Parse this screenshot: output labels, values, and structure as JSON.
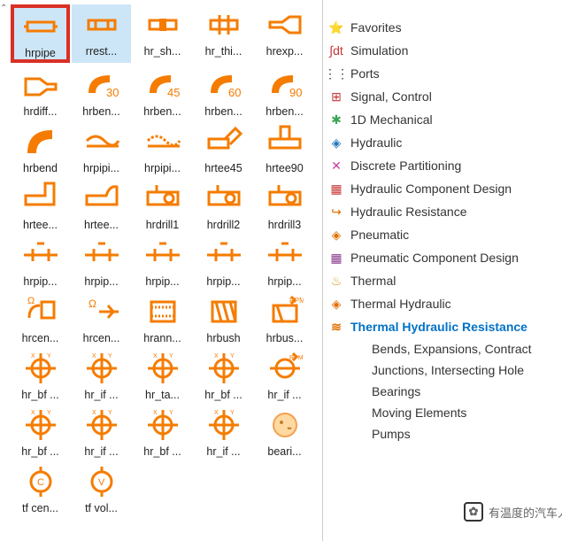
{
  "library": {
    "items": [
      {
        "label": "hrpipe",
        "icon": "pipe"
      },
      {
        "label": "rrest...",
        "icon": "pipe2"
      },
      {
        "label": "hr_sh...",
        "icon": "pipe3"
      },
      {
        "label": "hr_thi...",
        "icon": "pipe4"
      },
      {
        "label": "hrexp...",
        "icon": "expand"
      },
      {
        "label": "hrdiff...",
        "icon": "diff"
      },
      {
        "label": "hrben...",
        "icon": "bend30",
        "num": "30"
      },
      {
        "label": "hrben...",
        "icon": "bend45",
        "num": "45"
      },
      {
        "label": "hrben...",
        "icon": "bend60",
        "num": "60"
      },
      {
        "label": "hrben...",
        "icon": "bend90",
        "num": "90"
      },
      {
        "label": "hrbend",
        "icon": "bend"
      },
      {
        "label": "hrpipi...",
        "icon": "pipi1"
      },
      {
        "label": "hrpipi...",
        "icon": "pipi2"
      },
      {
        "label": "hrtee45",
        "icon": "tee45"
      },
      {
        "label": "hrtee90",
        "icon": "tee90"
      },
      {
        "label": "hrtee...",
        "icon": "tee1"
      },
      {
        "label": "hrtee...",
        "icon": "tee2"
      },
      {
        "label": "hrdrill1",
        "icon": "drill"
      },
      {
        "label": "hrdrill2",
        "icon": "drill"
      },
      {
        "label": "hrdrill3",
        "icon": "drill"
      },
      {
        "label": "hrpip...",
        "icon": "pip"
      },
      {
        "label": "hrpip...",
        "icon": "pip"
      },
      {
        "label": "hrpip...",
        "icon": "pip"
      },
      {
        "label": "hrpip...",
        "icon": "pip"
      },
      {
        "label": "hrpip...",
        "icon": "pip"
      },
      {
        "label": "hrcen...",
        "icon": "cen1"
      },
      {
        "label": "hrcen...",
        "icon": "cen2"
      },
      {
        "label": "hrann...",
        "icon": "ann"
      },
      {
        "label": "hrbush",
        "icon": "bush"
      },
      {
        "label": "hrbus...",
        "icon": "bush2"
      },
      {
        "label": "hr_bf ...",
        "icon": "hrx"
      },
      {
        "label": "hr_if ...",
        "icon": "hrx"
      },
      {
        "label": "hr_ta...",
        "icon": "hrx"
      },
      {
        "label": "hr_bf ...",
        "icon": "hrx"
      },
      {
        "label": "hr_if ...",
        "icon": "hrx2"
      },
      {
        "label": "hr_bf ...",
        "icon": "hrx"
      },
      {
        "label": "hr_if ...",
        "icon": "hrx"
      },
      {
        "label": "hr_bf ...",
        "icon": "hrx"
      },
      {
        "label": "hr_if ...",
        "icon": "hrx"
      },
      {
        "label": "beari...",
        "icon": "bearing"
      },
      {
        "label": "tf cen...",
        "icon": "tfc"
      },
      {
        "label": "tf vol...",
        "icon": "tfv"
      }
    ]
  },
  "tree": {
    "items": [
      {
        "label": "Favorites",
        "icon": "⭐",
        "color": "#e07000"
      },
      {
        "label": "Simulation",
        "icon": "∫dt",
        "color": "#c83737"
      },
      {
        "label": "Ports",
        "icon": "⋮⋮",
        "color": "#333"
      },
      {
        "label": "Signal, Control",
        "icon": "⊞",
        "color": "#c83737"
      },
      {
        "label": "1D Mechanical",
        "icon": "✱",
        "color": "#3aa655"
      },
      {
        "label": "Hydraulic",
        "icon": "◈",
        "color": "#2277bb"
      },
      {
        "label": "Discrete Partitioning",
        "icon": "✕",
        "color": "#c640a0"
      },
      {
        "label": "Hydraulic Component Design",
        "icon": "▦",
        "color": "#c83737"
      },
      {
        "label": "Hydraulic Resistance",
        "icon": "↪",
        "color": "#e07000"
      },
      {
        "label": "Pneumatic",
        "icon": "◈",
        "color": "#e07000"
      },
      {
        "label": "Pneumatic Component Design",
        "icon": "▦",
        "color": "#8b3a8b"
      },
      {
        "label": "Thermal",
        "icon": "♨",
        "color": "#d4a020"
      },
      {
        "label": "Thermal Hydraulic",
        "icon": "◈",
        "color": "#e07000"
      },
      {
        "label": "Thermal Hydraulic Resistance",
        "icon": "≋",
        "color": "#e07000",
        "selected": true
      }
    ],
    "subitems": [
      {
        "label": "Bends, Expansions, Contract"
      },
      {
        "label": "Junctions, Intersecting Hole"
      },
      {
        "label": "Bearings"
      },
      {
        "label": "Moving Elements"
      },
      {
        "label": "Pumps"
      }
    ]
  },
  "watermark": {
    "text": "有温度的汽车人"
  }
}
